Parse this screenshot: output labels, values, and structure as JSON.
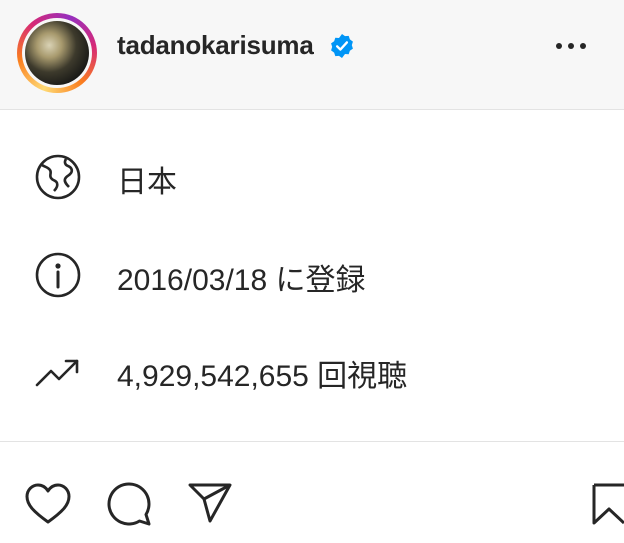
{
  "header": {
    "username": "tadanokarisuma",
    "avatar_icon": "profile-avatar",
    "verified_icon": "verified-badge-icon",
    "more_icon": "more-options-icon"
  },
  "about": {
    "items": [
      {
        "icon": "globe-icon",
        "text": "日本"
      },
      {
        "icon": "info-icon",
        "text": "2016/03/18 に登録"
      },
      {
        "icon": "trending-icon",
        "text": "4,929,542,655 回視聴"
      }
    ]
  },
  "actions": {
    "like_icon": "heart-icon",
    "comment_icon": "comment-icon",
    "share_icon": "share-icon",
    "save_icon": "bookmark-icon"
  },
  "colors": {
    "verified": "#0095f6",
    "text": "#262626",
    "header_bg": "#f7f7f7"
  }
}
